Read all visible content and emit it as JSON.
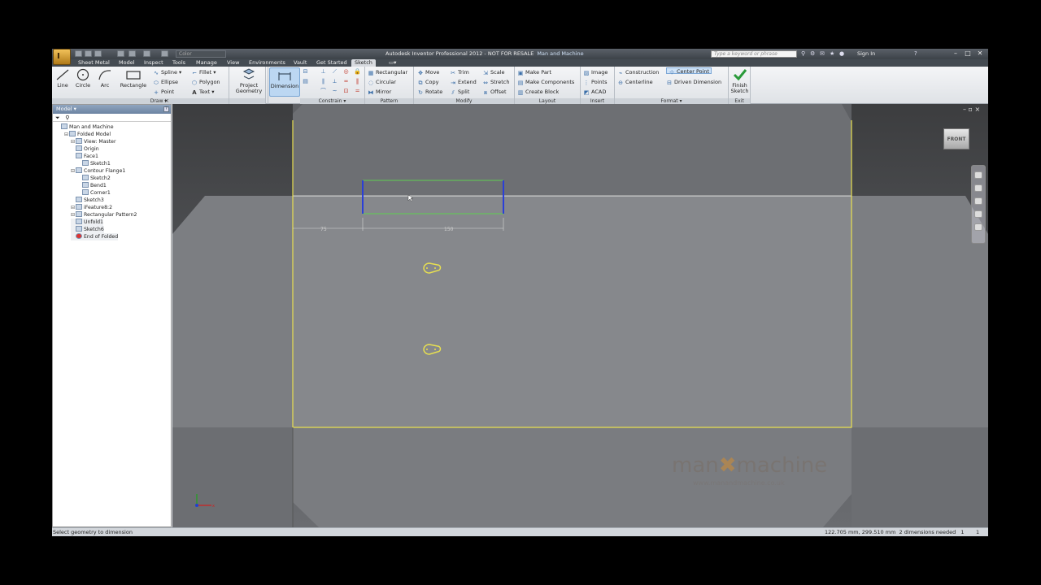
{
  "window": {
    "title": "Autodesk Inventor Professional 2012 - NOT FOR RESALE",
    "document": "Man and Machine",
    "app_button": "I",
    "color_dropdown": "Color",
    "search_placeholder": "Type a keyword or phrase",
    "sign_in": "Sign In"
  },
  "tabs": [
    "Sheet Metal",
    "Model",
    "Inspect",
    "Tools",
    "Manage",
    "View",
    "Environments",
    "Vault",
    "Get Started",
    "Sketch"
  ],
  "ribbon": {
    "draw": {
      "title": "Draw",
      "line": "Line",
      "circle": "Circle",
      "arc": "Arc",
      "rectangle": "Rectangle",
      "spline": "Spline",
      "ellipse": "Ellipse",
      "point": "Point",
      "fillet": "Fillet",
      "polygon": "Polygon",
      "text": "Text"
    },
    "project_geometry": [
      "Project",
      "Geometry"
    ],
    "dimension": "Dimension",
    "constrain": {
      "title": "Constrain"
    },
    "pattern": {
      "title": "Pattern",
      "rectangular": "Rectangular",
      "circular": "Circular",
      "mirror": "Mirror"
    },
    "modify": {
      "title": "Modify",
      "move": "Move",
      "copy": "Copy",
      "rotate": "Rotate",
      "trim": "Trim",
      "extend": "Extend",
      "split": "Split",
      "scale": "Scale",
      "stretch": "Stretch",
      "offset": "Offset"
    },
    "layout": {
      "title": "Layout",
      "make_part": "Make Part",
      "make_components": "Make Components",
      "create_block": "Create Block"
    },
    "insert": {
      "title": "Insert",
      "image": "Image",
      "points": "Points",
      "acad": "ACAD"
    },
    "format": {
      "title": "Format",
      "construction": "Construction",
      "centerline": "Centerline",
      "center_point": "Center Point",
      "driven_dimension": "Driven Dimension"
    },
    "exit": {
      "title": "Exit",
      "finish": [
        "Finish",
        "Sketch"
      ]
    }
  },
  "browser": {
    "title": "Model",
    "nodes": [
      {
        "label": "Man and Machine",
        "icon": "part-icon"
      },
      {
        "label": "Folded Model",
        "icon": "folded-model-icon"
      },
      {
        "label": "View: Master",
        "icon": "view-icon"
      },
      {
        "label": "Origin",
        "icon": "folder-icon"
      },
      {
        "label": "Face1",
        "icon": "face-icon"
      },
      {
        "label": "Sketch1",
        "icon": "sketch-icon"
      },
      {
        "label": "Contour Flange1",
        "icon": "contour-flange-icon"
      },
      {
        "label": "Sketch2",
        "icon": "sketch-icon"
      },
      {
        "label": "Bend1",
        "icon": "bend-icon"
      },
      {
        "label": "Corner1",
        "icon": "corner-icon"
      },
      {
        "label": "Sketch3",
        "icon": "sketch-icon"
      },
      {
        "label": "iFeature8:2",
        "icon": "ifeature-icon"
      },
      {
        "label": "Rectangular Pattern2",
        "icon": "pattern-icon"
      },
      {
        "label": "Unfold1",
        "icon": "unfold-icon"
      },
      {
        "label": "Sketch6",
        "icon": "sketch-icon"
      },
      {
        "label": "End of Folded",
        "icon": "end-of-part-icon"
      }
    ]
  },
  "viewport": {
    "viewcube_label": "FRONT",
    "dim_left": "75",
    "dim_right": "150",
    "watermark": {
      "left": "man",
      "mid": "✖",
      "right": "machine",
      "url": "www.manandmachine.co.uk"
    }
  },
  "status": {
    "prompt": "Select geometry to dimension",
    "coords": "122.705 mm, 299.510 mm",
    "dims_needed": "2 dimensions needed",
    "count1": "1",
    "count2": "1"
  }
}
